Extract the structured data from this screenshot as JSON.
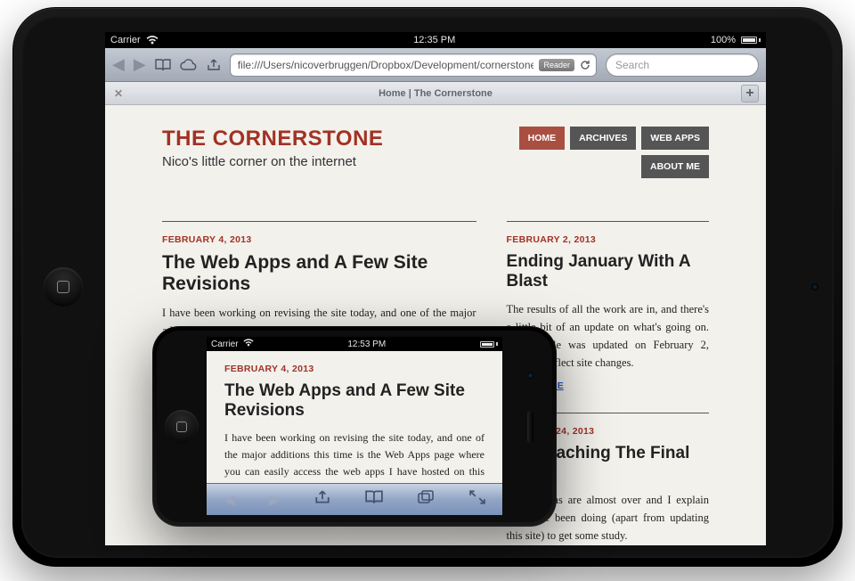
{
  "ipad": {
    "status": {
      "carrier": "Carrier",
      "time": "12:35 PM",
      "battery": "100%"
    },
    "url": "file:///Users/nicoverbruggen/Dropbox/Development/cornerstone-d",
    "reader_label": "Reader",
    "search_placeholder": "Search",
    "tab_close_glyph": "✕",
    "tab_add_glyph": "+",
    "tab_title": "Home | The Cornerstone"
  },
  "site": {
    "title": "THE CORNERSTONE",
    "subtitle": "Nico's little corner on the internet",
    "nav": {
      "home": "HOME",
      "archives": "ARCHIVES",
      "webapps": "WEB APPS",
      "about": "ABOUT ME"
    }
  },
  "posts": {
    "main": {
      "date": "FEBRUARY 4, 2013",
      "title": "The Web Apps and A Few Site Revisions",
      "body": "I have been working on revising the site today, and one of the major additions this time is the Web Apps page where you can easily access the web apps I have hosted on this domain. (For instance, the NMBS app I mentioned a few posts ago.)"
    },
    "side1": {
      "date": "FEBRUARY 2, 2013",
      "title": "Ending January With A Blast",
      "body": "The results of all the work are in, and there's a little bit of an update on what's going on. This article was updated on February 2, 2013, to reflect site changes.",
      "read_more": "READ MORE"
    },
    "side2": {
      "date": "JANUARY 24, 2013",
      "title": "Approaching The Final Exam",
      "body": "Most exams are almost over and I explain what I've been doing (apart from updating this site) to get some study."
    }
  },
  "iphone": {
    "status": {
      "carrier": "Carrier",
      "time": "12:53 PM"
    },
    "post": {
      "date": "FEBRUARY 4, 2013",
      "title": "The Web Apps and A Few Site Revisions",
      "body": "I have been working on revising the site today, and one of the major additions this time is the Web Apps page where you can easily access the web apps I have hosted on this domain. (For instance, the NMBS app I mentioned a few posts ago.)"
    }
  }
}
